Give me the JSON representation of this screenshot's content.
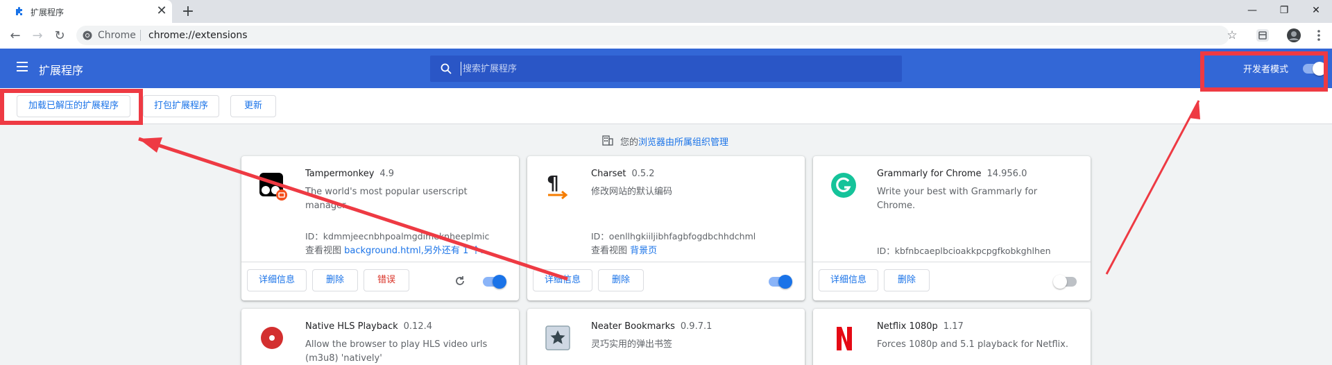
{
  "browser": {
    "tab_title": "扩展程序",
    "tab_close": "✕",
    "new_tab": "+",
    "window_minimize": "—",
    "window_restore": "❐",
    "window_close": "✕",
    "nav_back": "←",
    "nav_forward": "→",
    "nav_reload": "↻",
    "omnibox_site": "Chrome",
    "omnibox_url": "chrome://extensions",
    "bookmark_star": "☆"
  },
  "header": {
    "title": "扩展程序",
    "search_placeholder": "搜索扩展程序",
    "dev_mode_label": "开发者模式",
    "dev_mode_on": true,
    "accent": "#3367d6"
  },
  "subbar": {
    "load_unpacked": "加载已解压的扩展程序",
    "pack": "打包扩展程序",
    "update": "更新"
  },
  "managed": {
    "prefix": "您的",
    "link": "浏览器由所属组织管理"
  },
  "cards": [
    {
      "name": "Tampermonkey",
      "version": "4.9",
      "desc": "The world's most popular userscript manager",
      "id": "ID：kdmmjeecnbhpoalmgdimeknheeplmic",
      "views_label": "查看视图 ",
      "views_link": "background.html,另外还有 1 个...",
      "details": "详细信息",
      "remove": "删除",
      "errors": "错误",
      "enabled": true,
      "icon": "tampermonkey-icon"
    },
    {
      "name": "Charset",
      "version": "0.5.2",
      "desc": "修改网站的默认编码",
      "id": "ID：oenllhgkiiljibhfagbfogdbchhdchml",
      "views_label": "查看视图 ",
      "views_link": "背景页",
      "details": "详细信息",
      "remove": "删除",
      "enabled": true,
      "icon": "charset-pilcrow-icon"
    },
    {
      "name": "Grammarly for Chrome",
      "version": "14.956.0",
      "desc": "Write your best with Grammarly for Chrome.",
      "id": "ID：kbfnbcaeplbcioakkpcpgfkobkghlhen",
      "details": "详细信息",
      "remove": "删除",
      "enabled": false,
      "icon": "grammarly-icon"
    },
    {
      "name": "Native HLS Playback",
      "version": "0.12.4",
      "desc": "Allow the browser to play HLS video urls (m3u8) 'natively'",
      "icon": "native-hls-icon"
    },
    {
      "name": "Neater Bookmarks",
      "version": "0.9.7.1",
      "desc": "灵巧实用的弹出书签",
      "icon": "bookmark-star-icon"
    },
    {
      "name": "Netflix 1080p",
      "version": "1.17",
      "desc": "Forces 1080p and 5.1 playback for Netflix.",
      "icon": "netflix-icon"
    }
  ],
  "annotation_color": "#ee3a43"
}
